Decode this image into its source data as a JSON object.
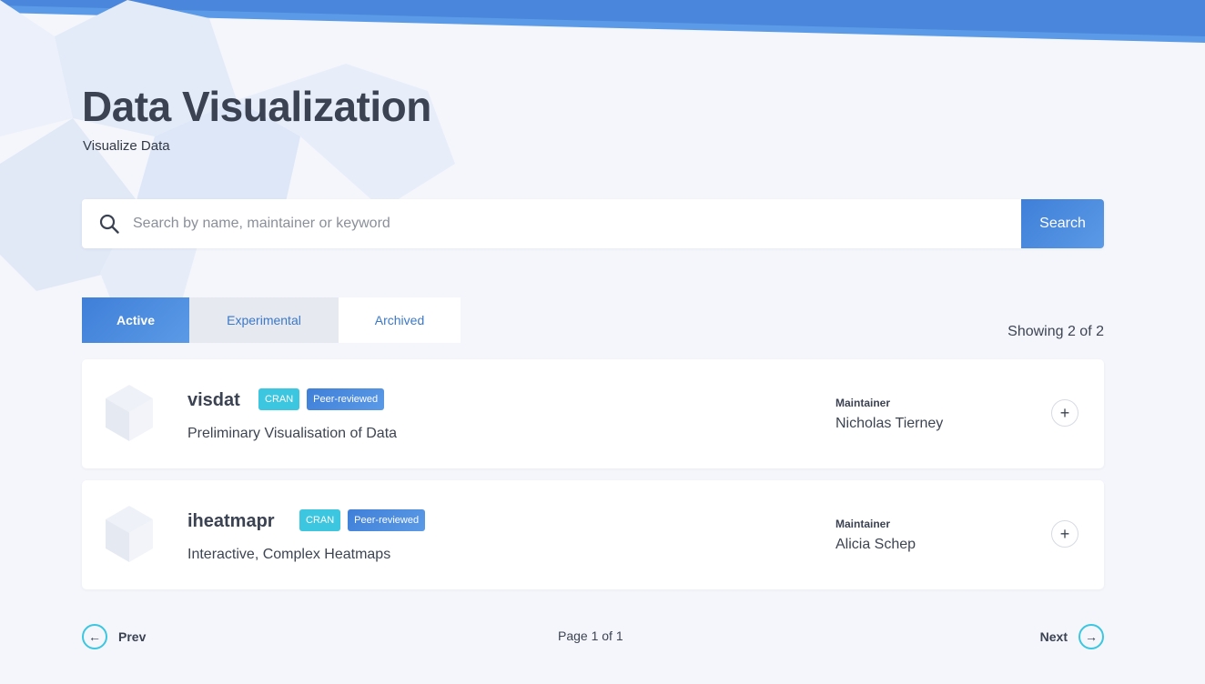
{
  "header": {
    "title": "Data Visualization",
    "subtitle": "Visualize Data"
  },
  "search": {
    "placeholder": "Search by name, maintainer or keyword",
    "button_label": "Search",
    "icon": "search-icon"
  },
  "tabs": [
    {
      "label": "Active",
      "selected": true
    },
    {
      "label": "Experimental",
      "selected": false
    },
    {
      "label": "Archived",
      "selected": false
    }
  ],
  "results": {
    "count_text": "Showing 2 of 2"
  },
  "packages": [
    {
      "name": "visdat",
      "badges": [
        "CRAN",
        "Peer-reviewed"
      ],
      "description": "Preliminary Visualisation of Data",
      "maintainer_label": "Maintainer",
      "maintainer": "Nicholas Tierney"
    },
    {
      "name": "iheatmapr",
      "badges": [
        "CRAN",
        "Peer-reviewed"
      ],
      "description": "Interactive, Complex Heatmaps",
      "maintainer_label": "Maintainer",
      "maintainer": "Alicia Schep"
    }
  ],
  "pagination": {
    "prev_label": "Prev",
    "next_label": "Next",
    "page_text": "Page 1 of 1",
    "prev_icon": "arrow-left-icon",
    "next_icon": "arrow-right-icon"
  },
  "colors": {
    "accent": "#4a8ae0",
    "badge_cran": "#3cc6e0",
    "heading": "#3b4252",
    "background": "#f4f6fb"
  }
}
